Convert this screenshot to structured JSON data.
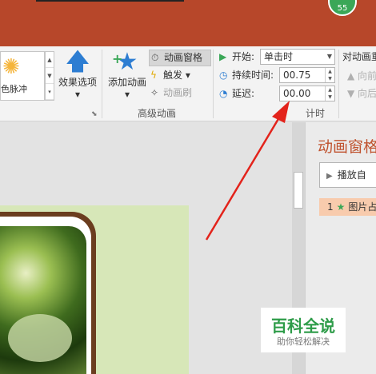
{
  "titlebar": {
    "avatar_badge": "55"
  },
  "ribbon": {
    "gallery": {
      "visible_label": "色脉冲",
      "icon": "star-burst-icon"
    },
    "effect_options": {
      "label": "效果选项",
      "dropdown": "▾"
    },
    "advanced": {
      "add_animation": {
        "label": "添加动画",
        "dropdown": "▾"
      },
      "animation_pane": "动画窗格",
      "trigger": "触发",
      "trigger_dropdown": "▾",
      "animation_painter": "动画刷",
      "group_label": "高级动画"
    },
    "timing": {
      "start_label": "开始:",
      "start_value": "单击时",
      "duration_label": "持续时间:",
      "duration_value": "00.75",
      "delay_label": "延迟:",
      "delay_value": "00.00",
      "group_label": "计时"
    },
    "reorder": {
      "label": "对动画重",
      "move_earlier": "▲ 向前",
      "move_later": "▼ 向后"
    }
  },
  "animation_pane": {
    "title": "动画窗格",
    "play_label": "播放自",
    "item": {
      "index": "1",
      "name": "图片占"
    }
  },
  "watermark": {
    "title": "百科全说",
    "subtitle": "助你轻松解决"
  },
  "colors": {
    "accent": "#b7472a",
    "pane_title": "#c0532f",
    "highlight": "#f8cbad",
    "arrow": "#e3231b"
  }
}
